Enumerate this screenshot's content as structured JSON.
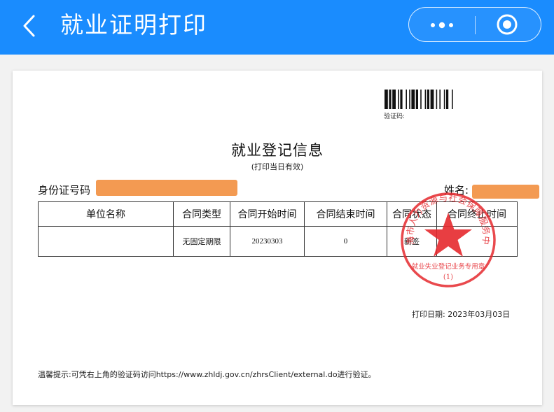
{
  "navbar": {
    "title": "就业证明打印",
    "back_icon": "chevron-left-icon",
    "more_icon": "more-dots-icon",
    "close_icon": "target-circle-icon",
    "bg_color": "#1a8cfe"
  },
  "document": {
    "verify_code_label": "验证码:",
    "title": "就业登记信息",
    "subtitle": "(打印当日有效)",
    "id_label": "身份证号码",
    "name_label": "姓名:",
    "table": {
      "headers": [
        "单位名称",
        "合同类型",
        "合同开始时间",
        "合同结束时间",
        "合同状态",
        "合同终止时间"
      ],
      "rows": [
        [
          "",
          "无固定期限",
          "20230303",
          "0",
          "新签",
          ""
        ]
      ]
    },
    "print_date": "打印日期: 2023年03月03日",
    "tip": "温馨提示:可凭右上角的验证码访问https://www.zhldj.gov.cn/zhrsClient/external.do进行验证。",
    "seal": {
      "arc_text": "珠海市人力资源与社会保障服务中心",
      "purpose_text": "就业失业登记业务专用章",
      "number_text": "(1)",
      "color": "#e5292e"
    },
    "redaction_color": "#f39a52"
  }
}
